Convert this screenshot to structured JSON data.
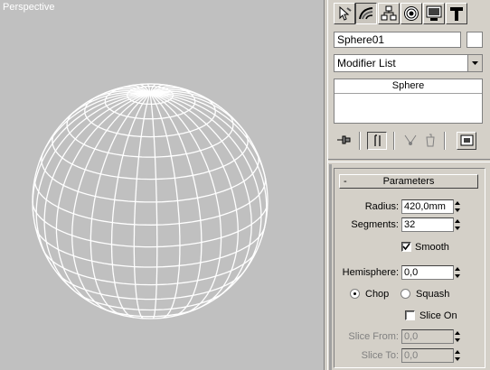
{
  "viewport": {
    "label": "Perspective"
  },
  "tabs": [
    {
      "name": "create-tab",
      "icon": "cursor-icon"
    },
    {
      "name": "modify-tab",
      "icon": "modify-curve-icon"
    },
    {
      "name": "hierarchy-tab",
      "icon": "hierarchy-icon"
    },
    {
      "name": "motion-tab",
      "icon": "motion-wheel-icon"
    },
    {
      "name": "display-tab",
      "icon": "display-monitor-icon"
    },
    {
      "name": "utilities-tab",
      "icon": "hammer-icon"
    }
  ],
  "object": {
    "name": "Sphere01",
    "color": "#ffffff"
  },
  "modifier_list": {
    "label": "Modifier List"
  },
  "stack": {
    "items": [
      "Sphere"
    ]
  },
  "parameters": {
    "title": "Parameters",
    "collapse_symbol": "-",
    "radius_label": "Radius:",
    "radius_value": "420,0mm",
    "segments_label": "Segments:",
    "segments_value": "32",
    "smooth_label": "Smooth",
    "smooth_checked": true,
    "hemisphere_label": "Hemisphere:",
    "hemisphere_value": "0,0",
    "chop_label": "Chop",
    "squash_label": "Squash",
    "chop_selected": true,
    "slice_on_label": "Slice On",
    "slice_on_checked": false,
    "slice_from_label": "Slice From:",
    "slice_from_value": "0,0",
    "slice_to_label": "Slice To:",
    "slice_to_value": "0,0"
  },
  "colors": {
    "viewport_bg": "#c0c0c0",
    "wire": "#ffffff",
    "panel_bg": "#d4d0c8"
  }
}
